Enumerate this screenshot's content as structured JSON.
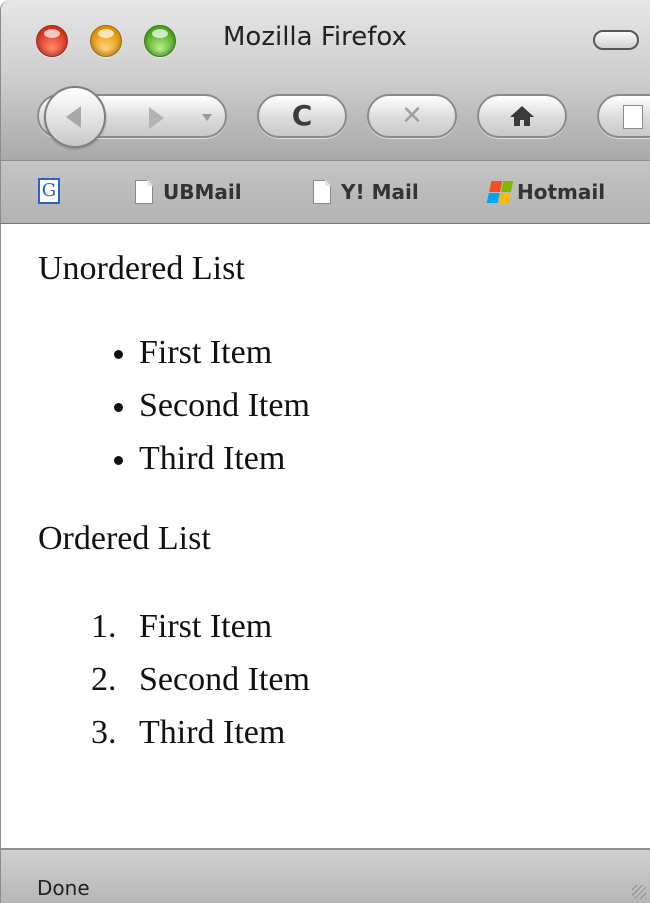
{
  "window": {
    "title": "Mozilla Firefox"
  },
  "navigation": {
    "back_icon": "back-arrow-icon",
    "forward_icon": "forward-arrow-icon",
    "history_icon": "chevron-down-icon",
    "reload_icon": "reload-icon",
    "reload_glyph": "C",
    "stop_icon": "stop-icon",
    "stop_glyph": "✕",
    "home_icon": "home-icon"
  },
  "bookmarks": {
    "google_letter": "G",
    "items": [
      {
        "label": "UBMail",
        "icon": "page-icon"
      },
      {
        "label": "Y! Mail",
        "icon": "page-icon"
      },
      {
        "label": "Hotmail",
        "icon": "windows-flag-icon"
      }
    ]
  },
  "content": {
    "unordered_heading": "Unordered List",
    "unordered_items": [
      "First Item",
      "Second Item",
      "Third Item"
    ],
    "ordered_heading": "Ordered List",
    "ordered_items": [
      "First Item",
      "Second Item",
      "Third Item"
    ],
    "ordered_numbers": [
      "1.",
      "2.",
      "3."
    ]
  },
  "status": {
    "text": "Done"
  },
  "colors": {
    "close": "#d8321b",
    "minimize": "#e59400",
    "zoom": "#49a51a"
  }
}
